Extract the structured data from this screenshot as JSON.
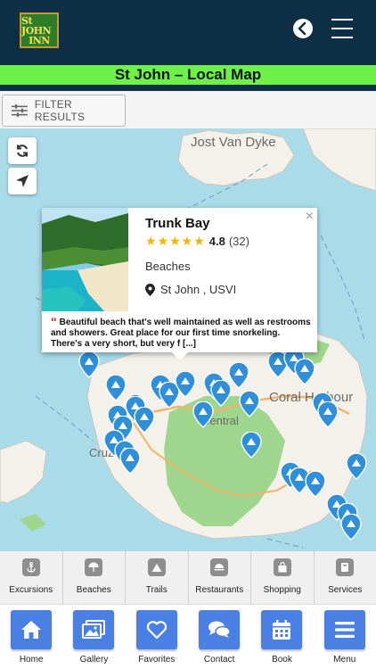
{
  "header": {
    "logo_line1": "St JOHN",
    "logo_line2": "INN",
    "back_icon": "chevron-left-circle",
    "menu_icon": "hamburger"
  },
  "title": "St John – Local Map",
  "filter": {
    "label": "FILTER RESULTS",
    "icon": "sliders-icon"
  },
  "map": {
    "controls": [
      {
        "name": "refresh",
        "icon": "refresh-icon"
      },
      {
        "name": "locate",
        "icon": "location-arrow-icon"
      }
    ],
    "labels": {
      "jost_van_dyke": "Jost Van Dyke",
      "central": "Central",
      "coral_harbour": "Coral Harbour",
      "cruz_bay": "Cruz Bay"
    },
    "colors": {
      "water": "#a9dbe9",
      "land": "#f3f1ea",
      "park": "#9fd68e",
      "pin": "#2f8fd8"
    }
  },
  "popup": {
    "name": "Trunk Bay",
    "stars": "★★★★★",
    "score": "4.8",
    "count": "(32)",
    "category": "Beaches",
    "location": "St John , USVI",
    "quote_mark": "\"",
    "review": "Beautiful beach that's well maintained as well as restrooms and showers.  Great place for our first time snorkeling. There's a very short, but very f [...]",
    "close": "×"
  },
  "categories": [
    {
      "label": "Excursions",
      "icon": "anchor-icon"
    },
    {
      "label": "Beaches",
      "icon": "umbrella-icon"
    },
    {
      "label": "Trails",
      "icon": "mountain-icon"
    },
    {
      "label": "Restaurants",
      "icon": "dish-icon"
    },
    {
      "label": "Shopping",
      "icon": "bag-icon"
    },
    {
      "label": "Services",
      "icon": "service-icon"
    }
  ],
  "nav": [
    {
      "label": "Home",
      "icon": "home-icon"
    },
    {
      "label": "Gallery",
      "icon": "gallery-icon"
    },
    {
      "label": "Favorites",
      "icon": "heart-icon"
    },
    {
      "label": "Contact",
      "icon": "chat-icon"
    },
    {
      "label": "Book",
      "icon": "calendar-icon"
    },
    {
      "label": "Menu",
      "icon": "menu-icon"
    }
  ]
}
